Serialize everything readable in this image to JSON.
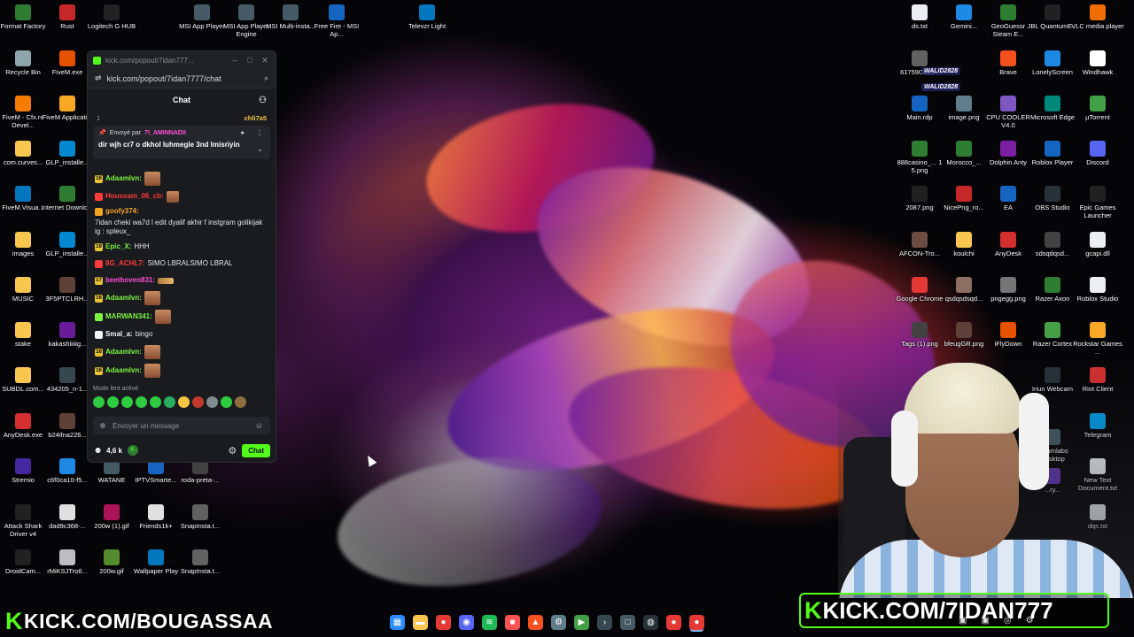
{
  "desktop_icons_left": [
    {
      "label": "Format Factory",
      "color": "#2e7d32"
    },
    {
      "label": "Rust",
      "color": "#c62828"
    },
    {
      "label": "Logitech G HUB",
      "color": "#222"
    },
    {
      "label": "MSI App Player",
      "color": "#455a64"
    },
    {
      "label": "MSI App Player Engine",
      "color": "#455a64"
    },
    {
      "label": "MSI Multi-insta...",
      "color": "#455a64"
    },
    {
      "label": "Free Fire - MSI Ap...",
      "color": "#1565c0"
    },
    {
      "label": "Televzr Light",
      "color": "#0277bd"
    },
    {
      "label": "Recycle Bin",
      "color": "#90a4ae"
    },
    {
      "label": "FiveM.exe",
      "color": "#e65100"
    },
    {
      "label": "FiveM - Cfx.re Devel...",
      "color": "#f57c00"
    },
    {
      "label": "FiveM Applicati...",
      "color": "#f9a825"
    },
    {
      "label": "com.curves...",
      "color": "#f9c74f"
    },
    {
      "label": "GLP_installe...",
      "color": "#0288d1"
    },
    {
      "label": "FiveM.Visua...",
      "color": "#0277bd"
    },
    {
      "label": "Internet Downlo...",
      "color": "#2e7d32"
    },
    {
      "label": "images",
      "color": "#f9c74f"
    },
    {
      "label": "GLP_installe...",
      "color": "#0288d1"
    },
    {
      "label": "MUSIC",
      "color": "#f9c74f"
    },
    {
      "label": "3F5PTCLRH...",
      "color": "#5d4037"
    },
    {
      "label": "stake",
      "color": "#f9c74f"
    },
    {
      "label": "kakashiiiiig...",
      "color": "#6a1b9a"
    },
    {
      "label": "SUBDL.com...",
      "color": "#f9c74f"
    },
    {
      "label": "434205_n-1...",
      "color": "#37474f"
    },
    {
      "label": "AnyDesk.exe",
      "color": "#d32f2f"
    },
    {
      "label": "b24ifna226...",
      "color": "#5d4037"
    },
    {
      "label": "Stremio",
      "color": "#4527a0"
    },
    {
      "label": "c6f0ca10-f5...",
      "color": "#1e88e5"
    },
    {
      "label": "WATANE",
      "color": "#455a64"
    },
    {
      "label": "IPTVSmarte...",
      "color": "#1565c0"
    },
    {
      "label": "roda-preta-...",
      "color": "#424242"
    },
    {
      "label": "Attack Shark Driver v4",
      "color": "#212121"
    },
    {
      "label": "dad9c368-...",
      "color": "#e0e0e0"
    },
    {
      "label": "200w (1).gif",
      "color": "#ad1457"
    },
    {
      "label": "Friends1k+",
      "color": "#e0e0e0"
    },
    {
      "label": "SnapInsta.t...",
      "color": "#616161"
    },
    {
      "label": "DroidCam...",
      "color": "#212121"
    },
    {
      "label": "rMiKSJTro6...",
      "color": "#bdbdbd"
    },
    {
      "label": "200w.gif",
      "color": "#558b2f"
    },
    {
      "label": "Wallpaper Play",
      "color": "#0277bd"
    },
    {
      "label": "SnapInsta.t...",
      "color": "#616161"
    }
  ],
  "desktop_icons_right": [
    {
      "label": "ds.txt",
      "color": "#eceff1"
    },
    {
      "label": "Gemini...",
      "color": "#1e88e5"
    },
    {
      "label": "GeoGuessr Steam E...",
      "color": "#2e7d32"
    },
    {
      "label": "JBL QuantumE...",
      "color": "#212121"
    },
    {
      "label": "VLC media player",
      "color": "#ef6c00"
    },
    {
      "label": "617590935...",
      "color": "#616161"
    },
    {
      "label": "Brave",
      "color": "#f4511e"
    },
    {
      "label": "LonelyScreen",
      "color": "#1e88e5"
    },
    {
      "label": "Windhawk",
      "color": "#ffffff"
    },
    {
      "label": "Main.rdp",
      "color": "#1565c0"
    },
    {
      "label": "image.png",
      "color": "#607d8b"
    },
    {
      "label": "CPU COOLER V4.0",
      "color": "#7e57c2"
    },
    {
      "label": "Microsoft Edge",
      "color": "#00897b"
    },
    {
      "label": "µTorrent",
      "color": "#43a047"
    },
    {
      "label": "888casino_... 1 5.png",
      "color": "#2e7d32"
    },
    {
      "label": "Morocco_...",
      "color": "#2e7d32"
    },
    {
      "label": "Dolphin Anty",
      "color": "#7b1fa2"
    },
    {
      "label": "Roblox Player",
      "color": "#1565c0"
    },
    {
      "label": "Discord",
      "color": "#5865f2"
    },
    {
      "label": "2087.png",
      "color": "#212121"
    },
    {
      "label": "NicePng_ro...",
      "color": "#c62828"
    },
    {
      "label": "EA",
      "color": "#1565c0"
    },
    {
      "label": "OBS Studio",
      "color": "#263238"
    },
    {
      "label": "Epic Games Launcher",
      "color": "#212121"
    },
    {
      "label": "AFCON-Tro...",
      "color": "#6d4c41"
    },
    {
      "label": "koulchi",
      "color": "#f9c74f"
    },
    {
      "label": "AnyDesk",
      "color": "#d32f2f"
    },
    {
      "label": "sdsqdqsd...",
      "color": "#424242"
    },
    {
      "label": "gcapi.dll",
      "color": "#eceff1"
    },
    {
      "label": "Google Chrome",
      "color": "#e53935"
    },
    {
      "label": "qsdqsdsqd...",
      "color": "#8d6e63"
    },
    {
      "label": "pngegg.png",
      "color": "#757575"
    },
    {
      "label": "Razer Axon",
      "color": "#2e7d32"
    },
    {
      "label": "Roblox Studio",
      "color": "#eceff1"
    },
    {
      "label": "Tags (1).png",
      "color": "#424242"
    },
    {
      "label": "bfeugGR.png",
      "color": "#5d4037"
    },
    {
      "label": "iFlyDown",
      "color": "#e65100"
    },
    {
      "label": "Razer Cortex",
      "color": "#43a047"
    },
    {
      "label": "Rockstar Games ...",
      "color": "#f9a825"
    },
    {
      "label": "Iriun Webcam",
      "color": "#263238"
    },
    {
      "label": "Riot Client",
      "color": "#d32f2f"
    },
    {
      "label": "Telegram",
      "color": "#039be5"
    },
    {
      "label": "New Text Document.txt",
      "color": "#eceff1"
    },
    {
      "label": "dqs.txt",
      "color": "#eceff1"
    },
    {
      "label": "Bo...",
      "color": "#424242"
    },
    {
      "label": "Steamlabs Desktop",
      "color": "#455a64"
    },
    {
      "label": "...ry...",
      "color": "#5e35b1"
    }
  ],
  "stack_tags": [
    "WALID2828",
    "WALID2828"
  ],
  "chat_window": {
    "title_url": "kick.com/popout/7idan777...",
    "url": "kick.com/popout/7idan7777/chat",
    "header": "Chat",
    "pin_count": "1",
    "top_supporter": "chli7a5",
    "pinned": {
      "sent_by_label": "Envoyé par",
      "sent_by_user": "7I_AMINNADII",
      "message": "dir wjh cr7 o dkhol luhmegle 3nd lmisriyin"
    },
    "messages": [
      {
        "badge": "16",
        "user": "Adaamlvn",
        "user_color": "#7ef542",
        "text": "",
        "emote": "face"
      },
      {
        "badge": "",
        "user": "Houssam_06_cb",
        "user_color": "#ff3b3b",
        "text": "",
        "emote": "face-small"
      },
      {
        "badge": "",
        "user": "goofy374",
        "user_color": "#f5a623",
        "text": "7idan cheki wa7d l edit dyalif akhir f instgram golikijak ig : spleux_",
        "emote": ""
      },
      {
        "badge": "19",
        "user": "Epic_X",
        "user_color": "#7ef542",
        "text": "HHH",
        "emote": ""
      },
      {
        "badge": "",
        "user": "8G_ACHL7",
        "user_color": "#ff3b3b",
        "text": "SIMO LBRALSIMO LBRAL",
        "emote": ""
      },
      {
        "badge": "17",
        "user": "beethoven831",
        "user_color": "#ff4fd8",
        "text": "",
        "emote": "gold"
      },
      {
        "badge": "16",
        "user": "Adaamlvn",
        "user_color": "#7ef542",
        "text": "",
        "emote": "face"
      },
      {
        "badge": "",
        "user": "MARWAN341",
        "user_color": "#7ef542",
        "text": "",
        "emote": "face"
      },
      {
        "badge": "",
        "user": "Smal_a",
        "user_color": "#f5f5f5",
        "text": "bingo",
        "emote": ""
      },
      {
        "badge": "16",
        "user": "Adaamlvn",
        "user_color": "#7ef542",
        "text": "",
        "emote": "face"
      },
      {
        "badge": "16",
        "user": "Adaamlvn",
        "user_color": "#7ef542",
        "text": "",
        "emote": "face"
      }
    ],
    "slow_mode": "Mode lent activé",
    "emote_colors": [
      "#2ecc40",
      "#2ecc40",
      "#2ecc40",
      "#2ecc40",
      "#2ecc40",
      "#27ae60",
      "#f5c542",
      "#c0392b",
      "#7f8c8d",
      "#2ecc40",
      "#8e6e3e"
    ],
    "input_placeholder": "Envoyer un message",
    "viewers": "4,6 k",
    "chat_button": "Chat"
  },
  "overlays": {
    "left_kick": {
      "k": "K",
      "text": "KICK.COM/BOUGASSAA"
    },
    "right_kick": {
      "k": "K",
      "text": "KICK.COM/7IDAN777"
    }
  },
  "taskbar": [
    {
      "name": "windows-start-icon",
      "color": "#2b8cff",
      "glyph": "▦"
    },
    {
      "name": "file-explorer-icon",
      "color": "#f9c74f",
      "glyph": "▬"
    },
    {
      "name": "chrome-icon",
      "color": "#e53935",
      "glyph": "●"
    },
    {
      "name": "discord-icon",
      "color": "#5865f2",
      "glyph": "◉"
    },
    {
      "name": "spotify-icon",
      "color": "#1db954",
      "glyph": "≋"
    },
    {
      "name": "screen-capture-icon",
      "color": "#ff5252",
      "glyph": "■"
    },
    {
      "name": "brave-icon",
      "color": "#f4511e",
      "glyph": "▲"
    },
    {
      "name": "settings-icon",
      "color": "#607d8b",
      "glyph": "⚙"
    },
    {
      "name": "play-icon",
      "color": "#43a047",
      "glyph": "▶"
    },
    {
      "name": "terminal-icon",
      "color": "#37474f",
      "glyph": "›"
    },
    {
      "name": "window-icon",
      "color": "#455a64",
      "glyph": "□"
    },
    {
      "name": "obs-icon",
      "color": "#263238",
      "glyph": "◍"
    },
    {
      "name": "chrome-alt-icon",
      "color": "#e53935",
      "glyph": "●"
    },
    {
      "name": "chrome-active-icon",
      "color": "#e53935",
      "glyph": "●"
    }
  ]
}
